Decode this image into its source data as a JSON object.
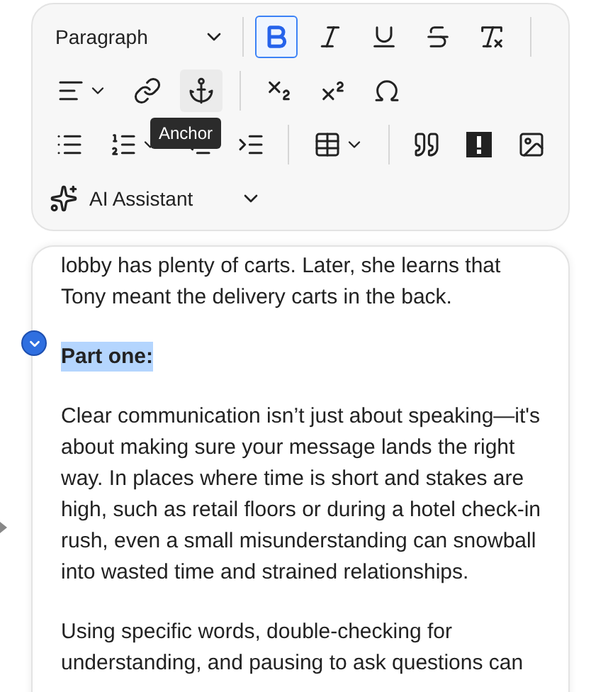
{
  "toolbar": {
    "block_format": {
      "label": "Paragraph"
    },
    "rows": [
      [
        {
          "kind": "bold",
          "active": true
        },
        {
          "kind": "italic",
          "active": false
        },
        {
          "kind": "underline",
          "active": false
        },
        {
          "kind": "strikethrough",
          "active": false
        },
        {
          "kind": "clear-format",
          "active": false
        },
        {
          "kind": "separator"
        }
      ],
      [
        {
          "kind": "align",
          "active": false
        },
        {
          "kind": "link",
          "active": false
        },
        {
          "kind": "anchor",
          "active": false,
          "hovered": true
        },
        {
          "kind": "separator"
        },
        {
          "kind": "subscript",
          "active": false
        },
        {
          "kind": "superscript",
          "active": false
        },
        {
          "kind": "omega",
          "active": false
        }
      ],
      [
        {
          "kind": "bullet-list",
          "active": false
        },
        {
          "kind": "numbered-list",
          "active": false
        },
        {
          "kind": "outdent",
          "active": false
        },
        {
          "kind": "indent",
          "active": false
        },
        {
          "kind": "separator"
        },
        {
          "kind": "table",
          "active": false
        },
        {
          "kind": "separator"
        },
        {
          "kind": "quote",
          "active": false
        },
        {
          "kind": "alert",
          "active": false
        },
        {
          "kind": "image",
          "active": false
        }
      ]
    ],
    "tooltip": "Anchor",
    "ai_assistant": {
      "label": "AI Assistant"
    }
  },
  "editor": {
    "blocks": [
      {
        "kind": "paragraph",
        "text": "lobby has plenty of carts. Later, she learns that Tony meant the delivery carts in the back."
      },
      {
        "kind": "heading",
        "text": "Part one:",
        "selected": true
      },
      {
        "kind": "paragraph",
        "text": "Clear communication isn’t just about speaking—it's about making sure your message lands the right way. In places where time is short and stakes are high, such as retail floors or during a hotel check-in rush, even a small misunderstanding can snowball into wasted time and strained relationships."
      },
      {
        "kind": "paragraph",
        "text": "Using specific words, double-checking for understanding, and pausing to ask questions can"
      }
    ]
  }
}
